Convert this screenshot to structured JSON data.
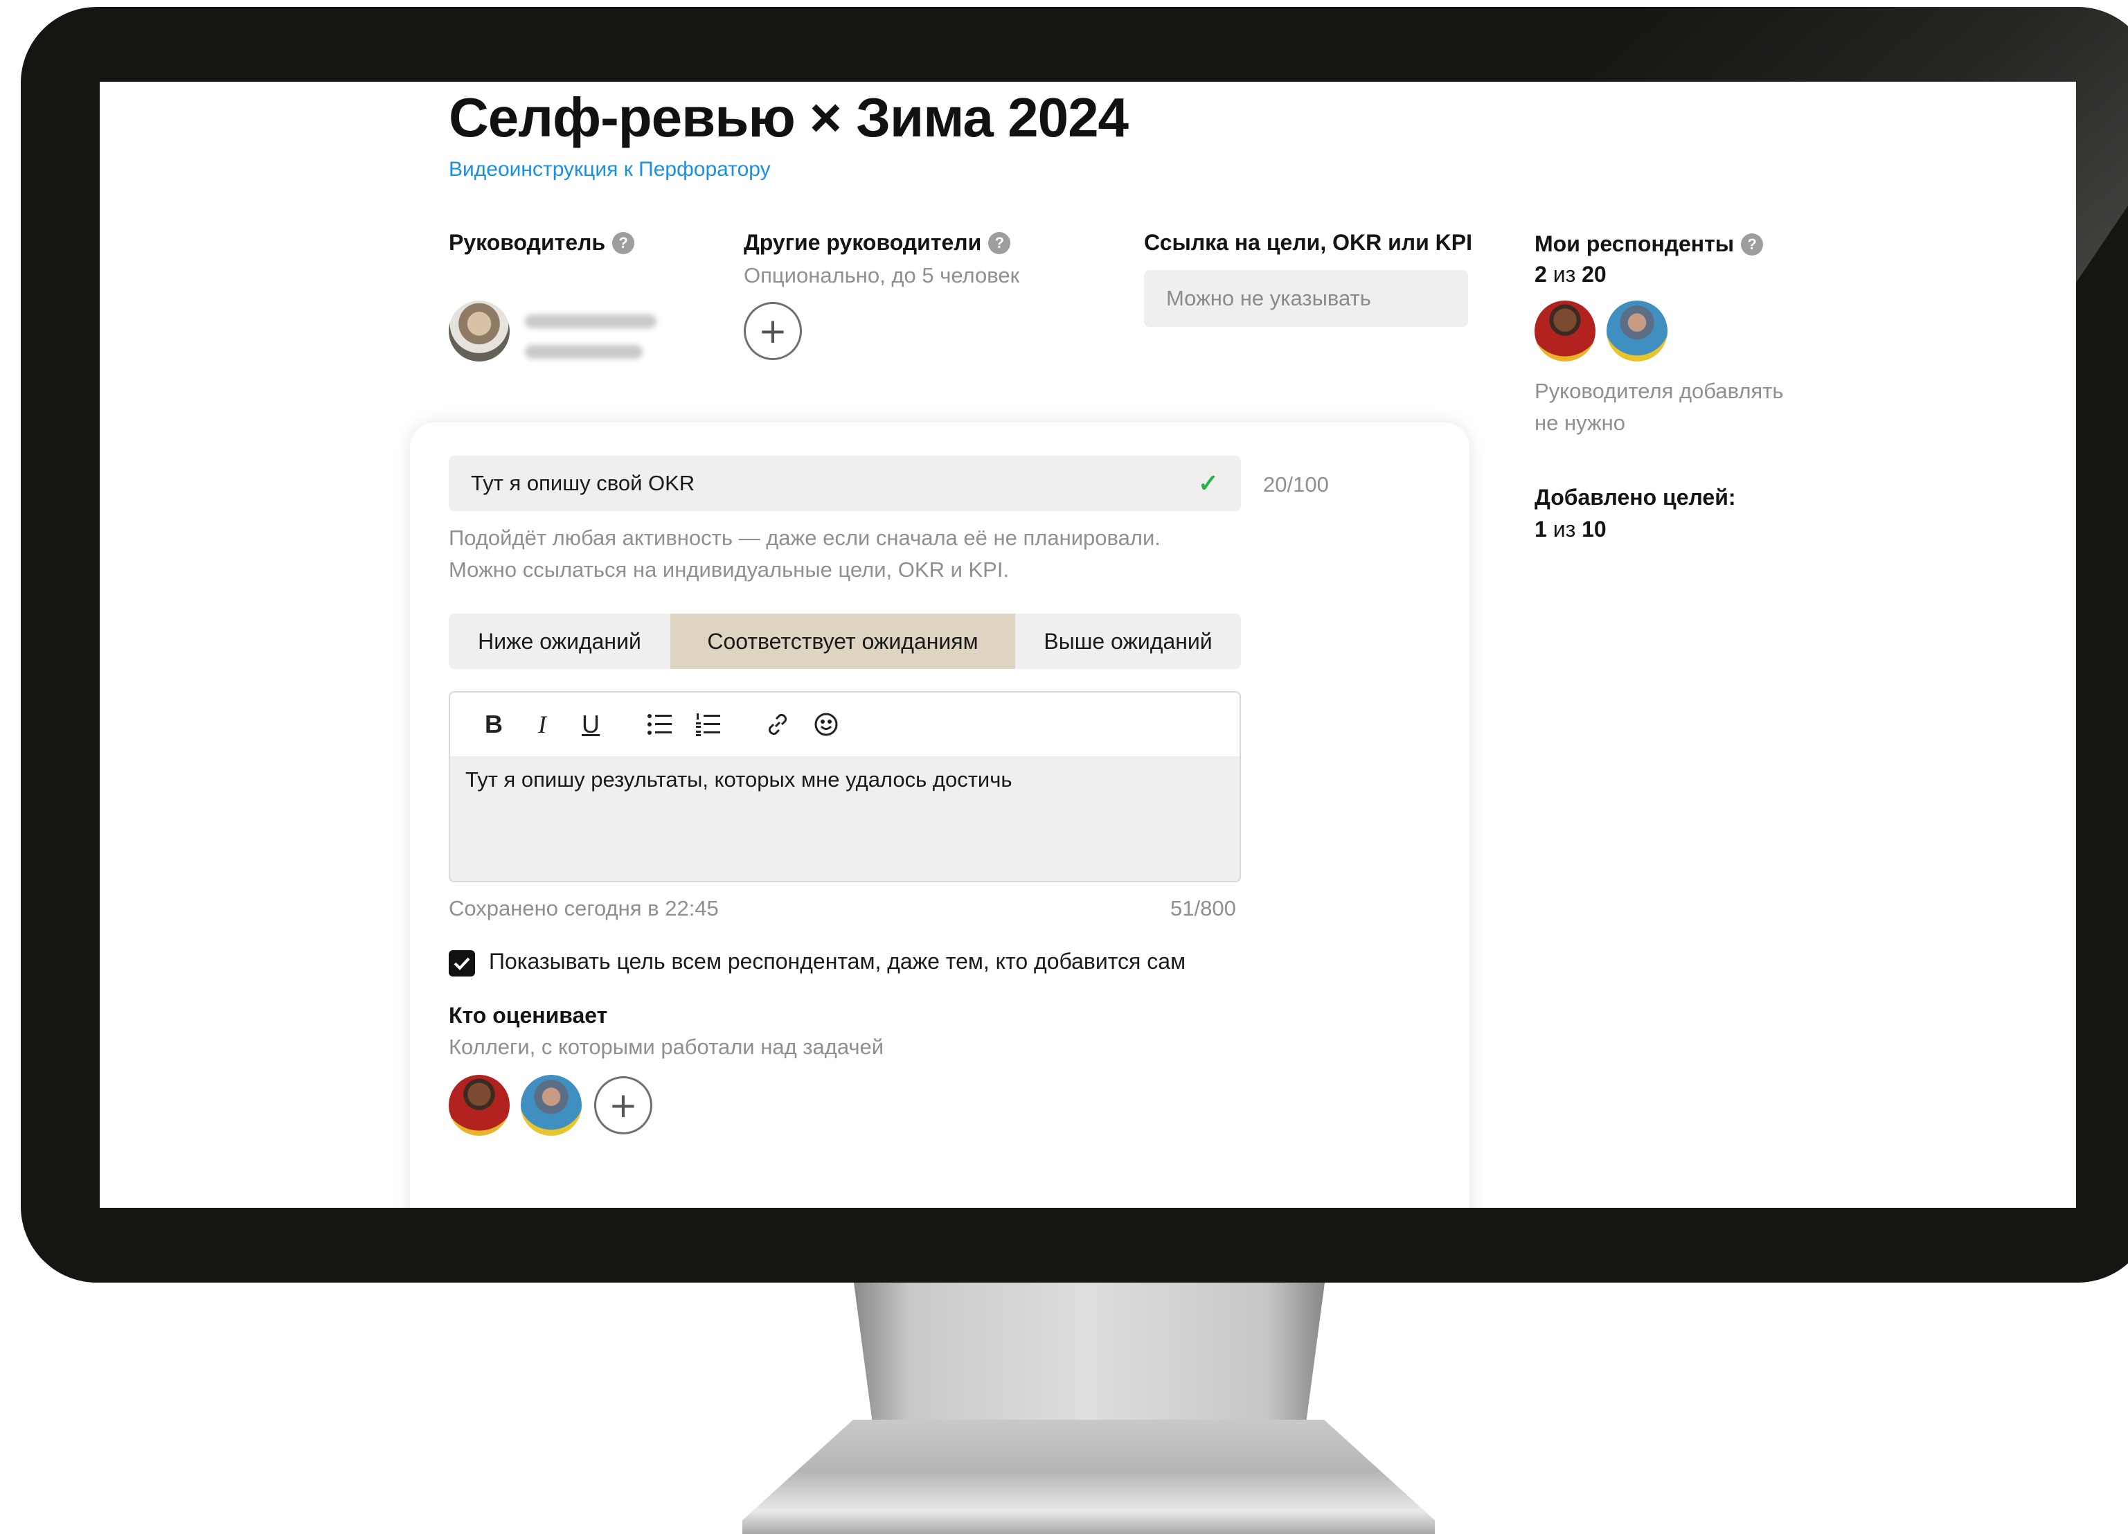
{
  "page": {
    "title": "Селф-ревью × Зима 2024",
    "video_link": "Видеоинструкция к Перфоратору"
  },
  "manager": {
    "label": "Руководитель",
    "help": "?"
  },
  "other_managers": {
    "label": "Другие руководители",
    "help": "?",
    "hint": "Опционально, до 5 человек",
    "add": "+"
  },
  "goals_link": {
    "label": "Ссылка на цели, OKR или KPI",
    "placeholder": "Можно не указывать"
  },
  "respondents": {
    "label": "Мои респонденты",
    "help": "?",
    "count_current": "2",
    "count_sep": " из ",
    "count_max": "20",
    "note_line1": "Руководителя добавлять",
    "note_line2": "не нужно"
  },
  "goals_added": {
    "label": "Добавлено целей:",
    "count_current": "1",
    "count_sep": " из ",
    "count_max": "10"
  },
  "goal_card": {
    "goal_title_value": "Тут я опишу свой OKR",
    "goal_title_check": "✓",
    "goal_title_counter": "20/100",
    "hint_line1": "Подойдёт любая активность — даже если сначала её не планировали.",
    "hint_line2": "Можно ссылаться на индивидуальные цели, OKR и KPI.",
    "ratings": [
      {
        "label": "Ниже ожиданий",
        "active": false
      },
      {
        "label": "Соответствует ожиданиям",
        "active": true
      },
      {
        "label": "Выше ожиданий",
        "active": false
      }
    ],
    "toolbar": {
      "bold": "B",
      "italic": "I",
      "underline": "U"
    },
    "editor_text": "Тут я опишу результаты, которых мне удалось достичь",
    "saved_status": "Сохранено сегодня в 22:45",
    "char_counter": "51/800",
    "show_to_all_checked": true,
    "show_to_all_label": "Показывать цель всем респондентам, даже тем, кто добавится сам",
    "evaluators_title": "Кто оценивает",
    "evaluators_hint": "Коллеги, с которыми работали над задачей",
    "add_evaluator": "+"
  },
  "colors": {
    "accent_link": "#1a8fe0",
    "active_segment": "#ddd4c2",
    "field_bg": "#f0efed",
    "check_green": "#2bb34b"
  }
}
